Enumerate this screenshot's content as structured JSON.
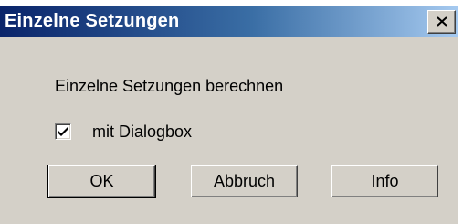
{
  "window": {
    "title": "Einzelne Setzungen",
    "close_glyph": "close-icon"
  },
  "message": "Einzelne Setzungen berechnen",
  "checkbox": {
    "label": "mit Dialogbox",
    "checked": true
  },
  "buttons": {
    "ok": "OK",
    "cancel": "Abbruch",
    "info": "Info"
  },
  "colors": {
    "title_start": "#0a246a",
    "title_end": "#a6caf0",
    "face": "#d4d0c8"
  }
}
